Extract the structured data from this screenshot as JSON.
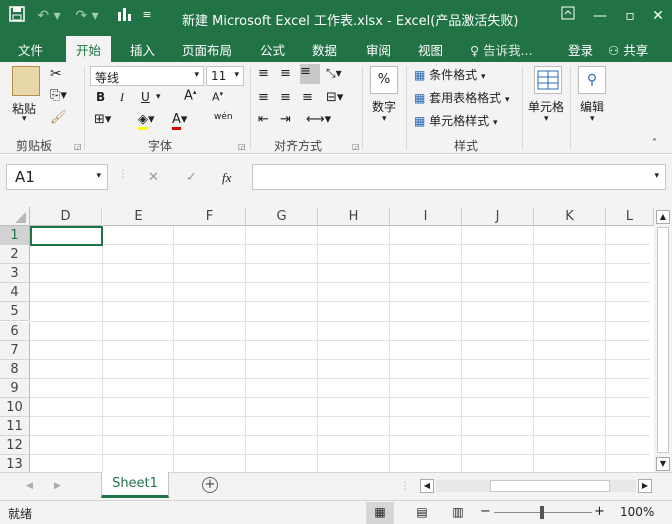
{
  "window": {
    "title": "新建 Microsoft Excel 工作表.xlsx - Excel(产品激活失败)",
    "accent_color": "#217346"
  },
  "quick_access": {
    "icons": [
      "save-icon",
      "undo-icon",
      "redo-icon",
      "chart-icon",
      "customize-icon"
    ]
  },
  "tabs": [
    {
      "label": "文件"
    },
    {
      "label": "开始",
      "active": true
    },
    {
      "label": "插入"
    },
    {
      "label": "页面布局"
    },
    {
      "label": "公式"
    },
    {
      "label": "数据"
    },
    {
      "label": "审阅"
    },
    {
      "label": "视图"
    }
  ],
  "tell_me": "告诉我...",
  "login": "登录",
  "share": "共享",
  "ribbon": {
    "clipboard": {
      "paste": "粘贴",
      "label": "剪贴板"
    },
    "font": {
      "label": "字体",
      "font_name": "等线",
      "font_size": "11",
      "bold": "B",
      "italic": "I",
      "underline": "U",
      "wen": "wén"
    },
    "alignment": {
      "label": "对齐方式"
    },
    "number": {
      "label": "数字",
      "percent": "%"
    },
    "styles": {
      "label": "样式",
      "conditional": "条件格式",
      "table_format": "套用表格格式",
      "cell_style": "单元格样式"
    },
    "cells": {
      "label": "单元格"
    },
    "editing": {
      "label": "编辑"
    }
  },
  "formula_bar": {
    "name_box": "A1",
    "fx": "fx",
    "value": ""
  },
  "columns": [
    "D",
    "E",
    "F",
    "G",
    "H",
    "I",
    "J",
    "K",
    "L"
  ],
  "rows": [
    "1",
    "2",
    "3",
    "4",
    "5",
    "6",
    "7",
    "8",
    "9",
    "10",
    "11",
    "12",
    "13"
  ],
  "sheet_tabs": [
    {
      "label": "Sheet1",
      "active": true
    }
  ],
  "status": {
    "text": "就绪",
    "zoom": "100%"
  }
}
